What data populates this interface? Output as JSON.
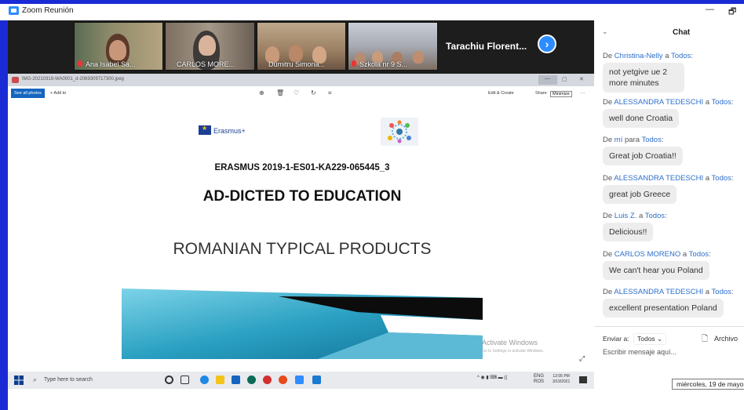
{
  "window": {
    "title": "Zoom Reunión",
    "minimize": "—",
    "restore": "🗗"
  },
  "video_strip": {
    "tiles": [
      {
        "name": "Ana Isabel Sa..."
      },
      {
        "name": "CARLOS MORE..."
      },
      {
        "name": "Dumitru Simona..."
      },
      {
        "name": "Szkola nr 9 S..."
      }
    ],
    "featured_name": "Tarachiu  Florent...",
    "next_arrow": "›"
  },
  "photos_app": {
    "filename": "IMG-20210319-WA0001_d-2069309717300.jpeg",
    "see_all": "See all photos",
    "add_to": "+ Add to",
    "edit_create": "Edit & Create",
    "share": "Share",
    "tooltip": "Minimize",
    "more": "···",
    "win_controls": {
      "min": "—",
      "max": "▢",
      "close": "✕"
    }
  },
  "slide": {
    "logo_text": "Erasmus+",
    "project_code": "ERASMUS 2019-1-ES01-KA229-065445_3",
    "title": "AD-DICTED TO EDUCATION",
    "subtitle": "ROMANIAN TYPICAL  PRODUCTS"
  },
  "watermark": {
    "title": "Activate Windows",
    "subtitle": "Go to Settings to activate Windows."
  },
  "taskbar": {
    "search_placeholder": "Type here to search",
    "language": "ENG",
    "region": "ROS",
    "time": "12:05 PM",
    "date": "3/19/2021"
  },
  "chat": {
    "title": "Chat",
    "messages": [
      {
        "from_prefix": "De ",
        "from": "Christina-Nelly",
        "to_prefix": " a ",
        "to": "Todos",
        "suffix": ":",
        "text": "not yetgive ue 2 more minutes"
      },
      {
        "from_prefix": "De ",
        "from": "ALESSANDRA TEDESCHI",
        "to_prefix": " a ",
        "to": "Todos",
        "suffix": ":",
        "text": "well done Croatia"
      },
      {
        "from_prefix": "De ",
        "from": "mí",
        "to_prefix": " para ",
        "to": "Todos",
        "suffix": ":",
        "text": "Great job Croatia!!"
      },
      {
        "from_prefix": "De ",
        "from": "ALESSANDRA TEDESCHI",
        "to_prefix": " a ",
        "to": "Todos",
        "suffix": ":",
        "text": "great job Greece"
      },
      {
        "from_prefix": "De ",
        "from": "Luis Z.",
        "to_prefix": " a ",
        "to": "Todos",
        "suffix": ":",
        "text": "Delicious!!"
      },
      {
        "from_prefix": "De ",
        "from": "CARLOS MORENO",
        "to_prefix": " a ",
        "to": "Todos",
        "suffix": ":",
        "text": "We can't hear you Poland"
      },
      {
        "from_prefix": "De ",
        "from": "ALESSANDRA TEDESCHI",
        "to_prefix": " a ",
        "to": "Todos",
        "suffix": ":",
        "text": "excellent presentation Poland"
      }
    ],
    "send_to_label": "Enviar a:",
    "send_to_value": "Todos ⌄",
    "file_label": "Archivo",
    "input_placeholder": "Escribir mensaje aquí...",
    "date_tooltip": "miércoles, 19 de mayo"
  },
  "colors": {
    "zoom_blue": "#1a2bd6",
    "chat_name": "#2d6fcb",
    "bubble": "#ededed"
  }
}
